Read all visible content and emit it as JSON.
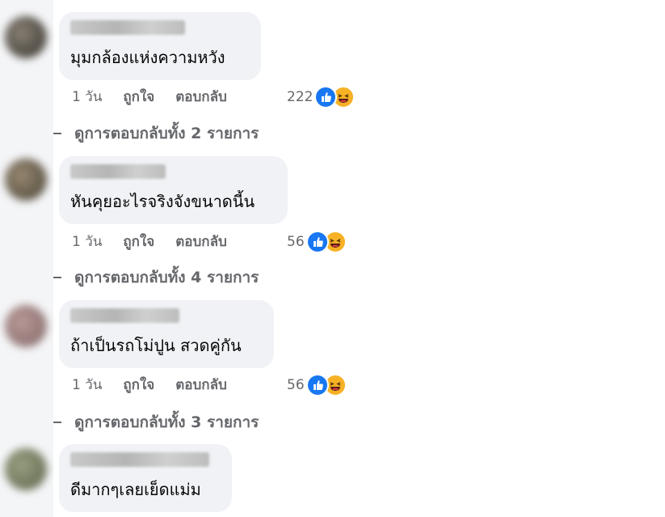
{
  "comments": [
    {
      "text": "มุมกล้องแห่งความหวัง",
      "time": "1 วัน",
      "like": "ถูกใจ",
      "reply": "ตอบกลับ",
      "reactions": "222",
      "view_replies": "ดูการตอบกลับทั้ง 2 รายการ"
    },
    {
      "text": "หันคุยอะไรจริงจังขนาดนี้น",
      "time": "1 วัน",
      "like": "ถูกใจ",
      "reply": "ตอบกลับ",
      "reactions": "56",
      "view_replies": "ดูการตอบกลับทั้ง 4 รายการ"
    },
    {
      "text": "ถ้าเป็นรถโม่ปูน สวดคู่กัน",
      "time": "1 วัน",
      "like": "ถูกใจ",
      "reply": "ตอบกลับ",
      "reactions": "56",
      "view_replies": "ดูการตอบกลับทั้ง 3 รายการ"
    },
    {
      "text": "ดีมากๆเลยเย็ดแม่ม"
    }
  ],
  "icons": {
    "like": "like-reaction-icon",
    "haha": "haha-reaction-icon"
  },
  "colors": {
    "bubble": "#f0f2f5",
    "meta_text": "#65676b",
    "like_blue": "#1877f2",
    "haha_yellow": "#f7b125"
  }
}
